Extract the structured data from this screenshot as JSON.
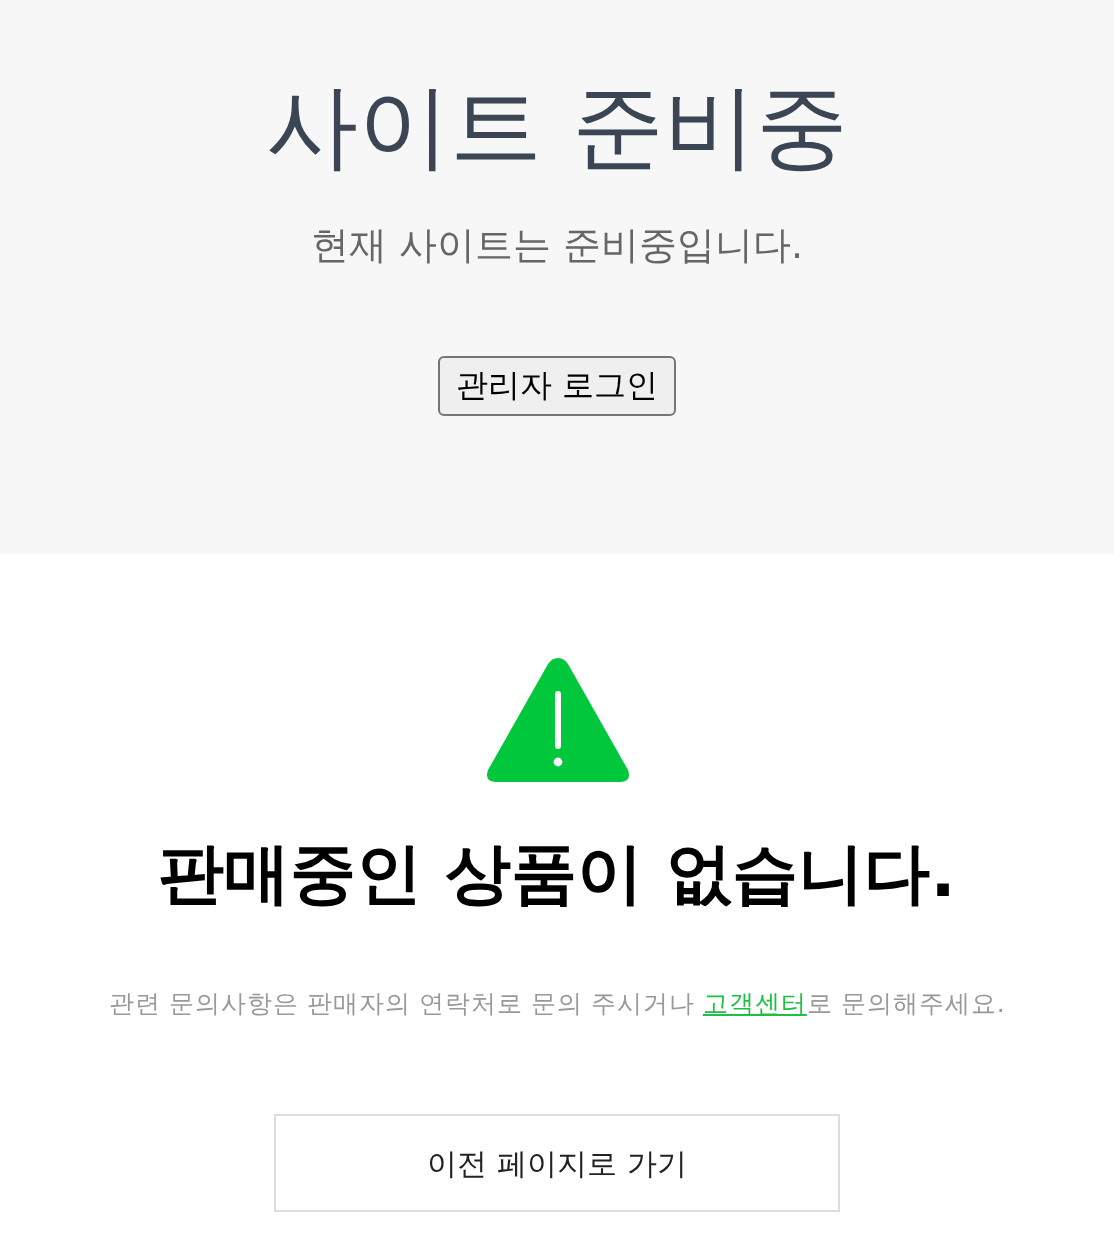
{
  "maintenance": {
    "title": "사이트 준비중",
    "message": "현재 사이트는 준비중입니다.",
    "login_button": "관리자 로그인"
  },
  "notice": {
    "heading": "판매중인 상품이 없습니다.",
    "message_before": "관련 문의사항은 판매자의 연락처로 문의 주시거나 ",
    "link": "고객센터",
    "message_after": "로 문의해주세요.",
    "back_button": "이전 페이지로 가기"
  }
}
